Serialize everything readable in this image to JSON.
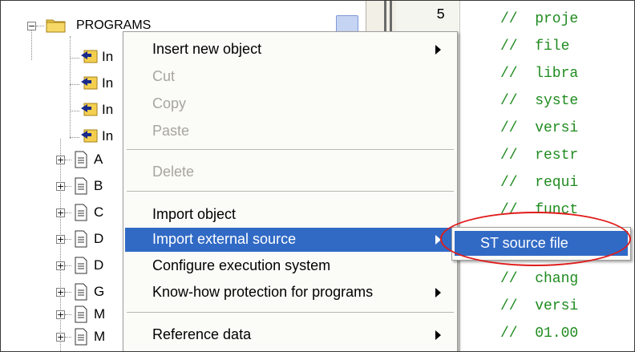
{
  "tree": {
    "root_label": "PROGRAMS",
    "inserted_items": [
      "In",
      "In",
      "In",
      "In"
    ],
    "items": [
      "A",
      "B",
      "C",
      "D",
      "D",
      "G",
      "M",
      "M"
    ]
  },
  "code": {
    "line_number": "5",
    "lines": [
      "//  proje",
      "//  file ",
      "//  libra",
      "//  syste",
      "//  versi",
      "//  restr",
      "//  requi",
      "//  funct",
      "",
      "//  chang",
      "//  versi",
      "//  01.00"
    ]
  },
  "context_menu": {
    "items": [
      {
        "label": "Insert new object",
        "enabled": true,
        "submenu": true
      },
      {
        "label": "Cut",
        "enabled": false
      },
      {
        "label": "Copy",
        "enabled": false
      },
      {
        "label": "Paste",
        "enabled": false
      },
      {
        "label": "Delete",
        "enabled": false
      },
      {
        "label": "Import object",
        "enabled": true
      },
      {
        "label": "Import external source",
        "enabled": true,
        "submenu": true,
        "highlighted": true
      },
      {
        "label": "Configure execution system",
        "enabled": true
      },
      {
        "label": "Know-how protection for programs",
        "enabled": true,
        "submenu": true
      },
      {
        "label": "Reference data",
        "enabled": true,
        "submenu": true
      }
    ]
  },
  "submenu": {
    "items": [
      {
        "label": "ST source file",
        "highlighted": true
      }
    ]
  },
  "colors": {
    "highlight": "#316ac5",
    "comment_green": "#1f8b1f",
    "annotation_red": "#e01b1b"
  }
}
